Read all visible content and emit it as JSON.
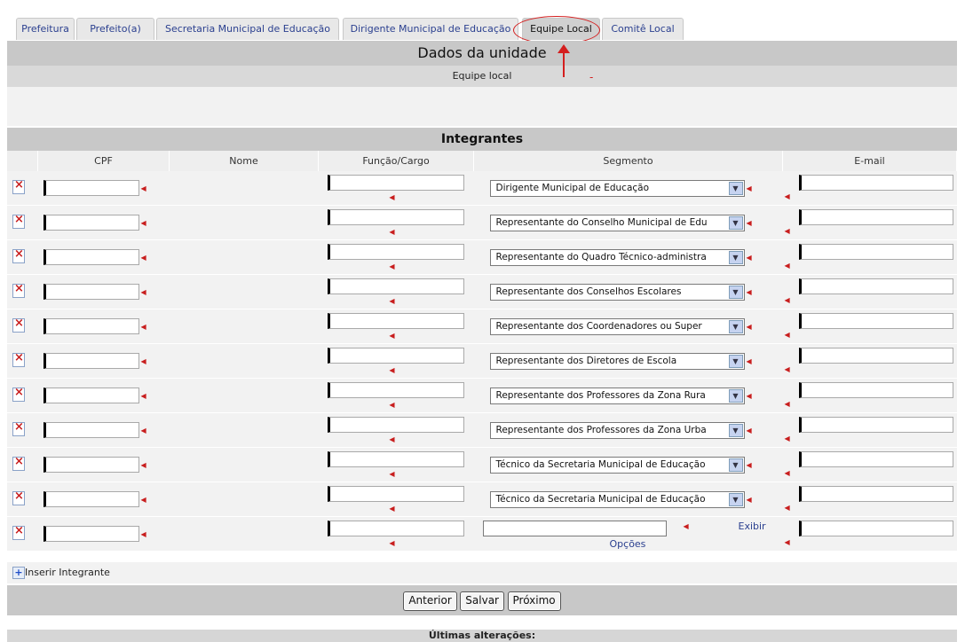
{
  "tabs": [
    "Prefeitura",
    "Prefeito(a)",
    "Secretaria Municipal de Educação",
    "Dirigente Municipal de Educação",
    "Equipe Local",
    "Comitê Local"
  ],
  "active_tab": "Equipe Local",
  "header": {
    "title": "Dados da unidade",
    "subtitle": "Equipe local",
    "annotation_mark": "-"
  },
  "integrantes": {
    "title": "Integrantes",
    "columns": [
      "CPF",
      "Nome",
      "Função/Cargo",
      "Segmento",
      "E-mail"
    ],
    "rows": [
      {
        "segmento": "Dirigente Municipal de Educação"
      },
      {
        "segmento": "Representante do Conselho Municipal de Edu"
      },
      {
        "segmento": "Representante do Quadro Técnico-administra"
      },
      {
        "segmento": "Representante dos Conselhos Escolares"
      },
      {
        "segmento": "Representante dos Coordenadores ou Super"
      },
      {
        "segmento": "Representante dos Diretores de Escola"
      },
      {
        "segmento": "Representante dos Professores da Zona Rura"
      },
      {
        "segmento": "Representante dos Professores da Zona Urba"
      },
      {
        "segmento": "Técnico da Secretaria Municipal de Educação"
      },
      {
        "segmento": "Técnico da Secretaria Municipal de Educação"
      }
    ],
    "last_row": {
      "exibir": "Exibir",
      "opcoes": "Opções"
    }
  },
  "insert_label": "Inserir Integrante",
  "buttons": {
    "anterior": "Anterior",
    "salvar": "Salvar",
    "proximo": "Próximo"
  },
  "footer": "Últimas alterações:",
  "colors": {
    "bar": "#c8c8c8",
    "link": "#2a3f8f",
    "required": "#c81e1e",
    "highlight": "#d41e1e"
  }
}
